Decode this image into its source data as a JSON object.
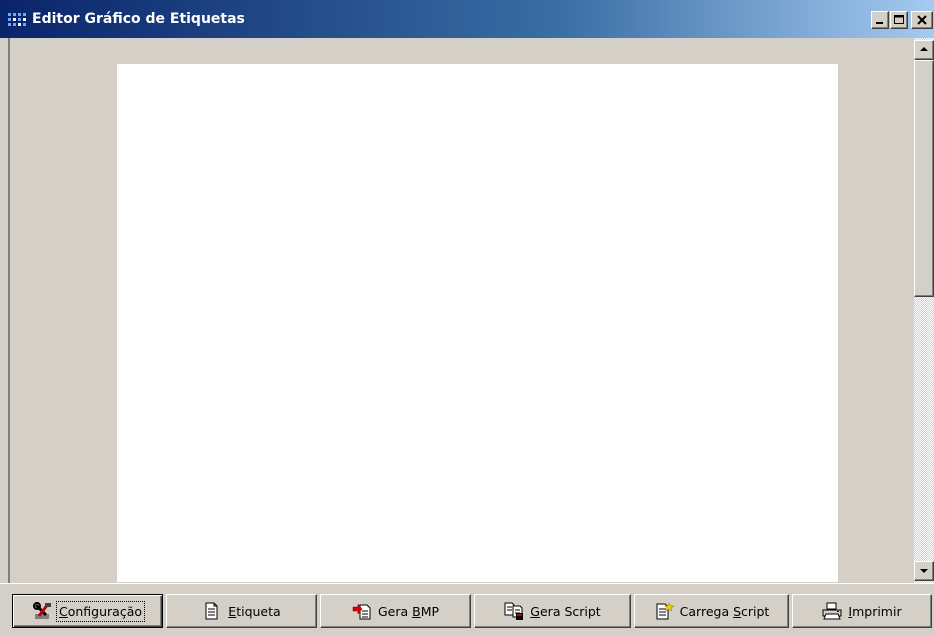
{
  "window": {
    "title": "Editor Gráfico de Etiquetas",
    "icon": "app-grid-icon",
    "controls": {
      "minimize": "_",
      "maximize": "□",
      "close": "✕"
    }
  },
  "canvas": {
    "background": "#ffffff"
  },
  "scrollbar": {
    "thumb_position": 0.0
  },
  "toolbar": {
    "buttons": [
      {
        "pre": "",
        "key": "C",
        "post": "onfiguração",
        "icon": "tools-icon"
      },
      {
        "pre": "",
        "key": "E",
        "post": "tiqueta",
        "icon": "document-icon"
      },
      {
        "pre": "Gera ",
        "key": "B",
        "post": "MP",
        "icon": "export-bmp-icon"
      },
      {
        "pre": "",
        "key": "G",
        "post": "era Script",
        "icon": "generate-script-icon"
      },
      {
        "pre": "Carrega ",
        "key": "S",
        "post": "cript",
        "icon": "load-script-icon"
      },
      {
        "pre": "",
        "key": "I",
        "post": "mprimir",
        "icon": "printer-icon"
      }
    ]
  },
  "colors": {
    "titlebar_start": "#0a246a",
    "titlebar_end": "#a6caf0",
    "face": "#d4d0c8"
  }
}
